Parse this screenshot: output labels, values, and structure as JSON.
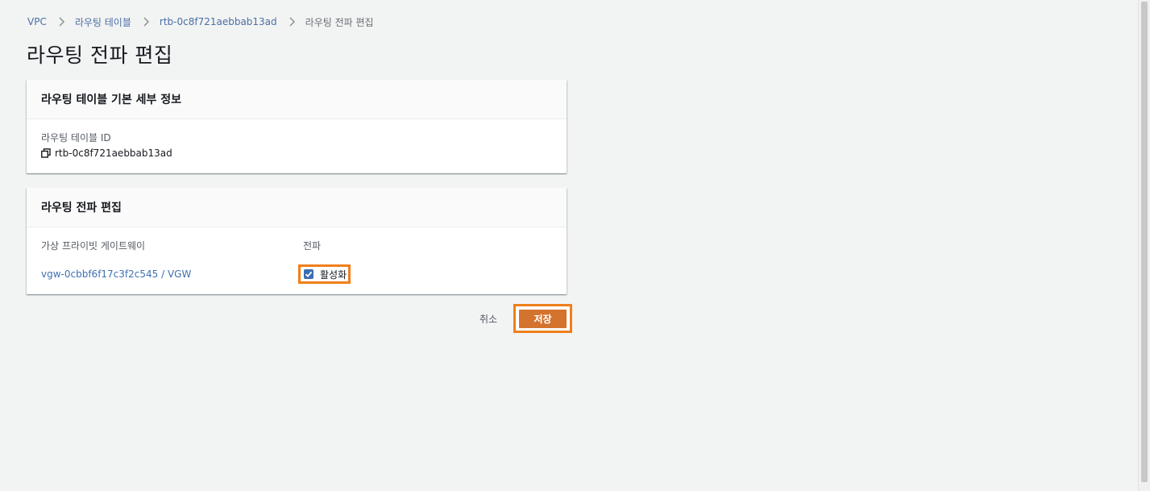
{
  "breadcrumb": {
    "items": [
      "VPC",
      "라우팅 테이블",
      "rtb-0c8f721aebbab13ad"
    ],
    "current": "라우팅 전파 편집"
  },
  "page_title": "라우팅 전파 편집",
  "details_panel": {
    "title": "라우팅 테이블 기본 세부 정보",
    "id_label": "라우팅 테이블 ID",
    "id_value": "rtb-0c8f721aebbab13ad"
  },
  "propagation_panel": {
    "title": "라우팅 전파 편집",
    "col_gateway": "가상 프라이빗 게이트웨이",
    "col_propagation": "전파",
    "gateway_link": "vgw-0cbbf6f17c3f2c545 / VGW",
    "checkbox_label": "활성화",
    "checkbox_checked": true
  },
  "actions": {
    "cancel_label": "취소",
    "save_label": "저장"
  },
  "colors": {
    "accent_orange": "#f07f1b",
    "primary_button": "#d4732e",
    "link_blue": "#3f6fb0",
    "checkbox_blue": "#3b6db3"
  }
}
